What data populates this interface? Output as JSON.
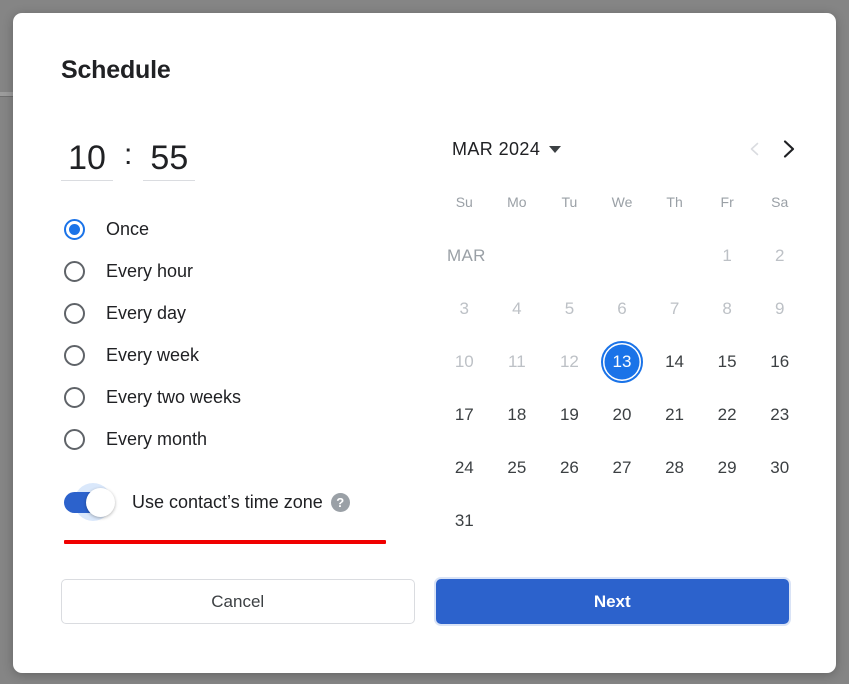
{
  "dialog": {
    "title": "Schedule"
  },
  "time": {
    "hour": "10",
    "separator": ":",
    "minute": "55"
  },
  "frequency": {
    "options": [
      {
        "label": "Once",
        "selected": true
      },
      {
        "label": "Every hour",
        "selected": false
      },
      {
        "label": "Every day",
        "selected": false
      },
      {
        "label": "Every week",
        "selected": false
      },
      {
        "label": "Every two weeks",
        "selected": false
      },
      {
        "label": "Every month",
        "selected": false
      }
    ]
  },
  "timezone_toggle": {
    "label": "Use contact’s time zone",
    "state": "on",
    "help_icon": "?"
  },
  "calendar": {
    "month_label": "MAR 2024",
    "month_short": "MAR",
    "prev_enabled": false,
    "next_enabled": true,
    "weekdays": [
      "Su",
      "Mo",
      "Tu",
      "We",
      "Th",
      "Fr",
      "Sa"
    ],
    "selected_day": "13",
    "weeks": [
      [
        {
          "label": "MAR",
          "type": "monthlabel"
        },
        {
          "label": "",
          "type": "empty"
        },
        {
          "label": "",
          "type": "empty"
        },
        {
          "label": "",
          "type": "empty"
        },
        {
          "label": "",
          "type": "empty"
        },
        {
          "label": "1",
          "type": "muted"
        },
        {
          "label": "2",
          "type": "muted"
        }
      ],
      [
        {
          "label": "3",
          "type": "muted"
        },
        {
          "label": "4",
          "type": "muted"
        },
        {
          "label": "5",
          "type": "muted"
        },
        {
          "label": "6",
          "type": "muted"
        },
        {
          "label": "7",
          "type": "muted"
        },
        {
          "label": "8",
          "type": "muted"
        },
        {
          "label": "9",
          "type": "muted"
        }
      ],
      [
        {
          "label": "10",
          "type": "muted"
        },
        {
          "label": "11",
          "type": "muted"
        },
        {
          "label": "12",
          "type": "muted"
        },
        {
          "label": "13",
          "type": "selected"
        },
        {
          "label": "14",
          "type": "normal"
        },
        {
          "label": "15",
          "type": "normal"
        },
        {
          "label": "16",
          "type": "normal"
        }
      ],
      [
        {
          "label": "17",
          "type": "normal"
        },
        {
          "label": "18",
          "type": "normal"
        },
        {
          "label": "19",
          "type": "normal"
        },
        {
          "label": "20",
          "type": "normal"
        },
        {
          "label": "21",
          "type": "normal"
        },
        {
          "label": "22",
          "type": "normal"
        },
        {
          "label": "23",
          "type": "normal"
        }
      ],
      [
        {
          "label": "24",
          "type": "normal"
        },
        {
          "label": "25",
          "type": "normal"
        },
        {
          "label": "26",
          "type": "normal"
        },
        {
          "label": "27",
          "type": "normal"
        },
        {
          "label": "28",
          "type": "normal"
        },
        {
          "label": "29",
          "type": "normal"
        },
        {
          "label": "30",
          "type": "normal"
        }
      ],
      [
        {
          "label": "31",
          "type": "normal"
        },
        {
          "label": "",
          "type": "empty"
        },
        {
          "label": "",
          "type": "empty"
        },
        {
          "label": "",
          "type": "empty"
        },
        {
          "label": "",
          "type": "empty"
        },
        {
          "label": "",
          "type": "empty"
        },
        {
          "label": "",
          "type": "empty"
        }
      ]
    ]
  },
  "footer": {
    "cancel_label": "Cancel",
    "next_label": "Next"
  },
  "annotation": {
    "color": "#f00000"
  },
  "colors": {
    "accent": "#1a73e8",
    "primary_button": "#2c62cc",
    "backdrop": "#858585",
    "muted_text": "#bdc1c6"
  }
}
